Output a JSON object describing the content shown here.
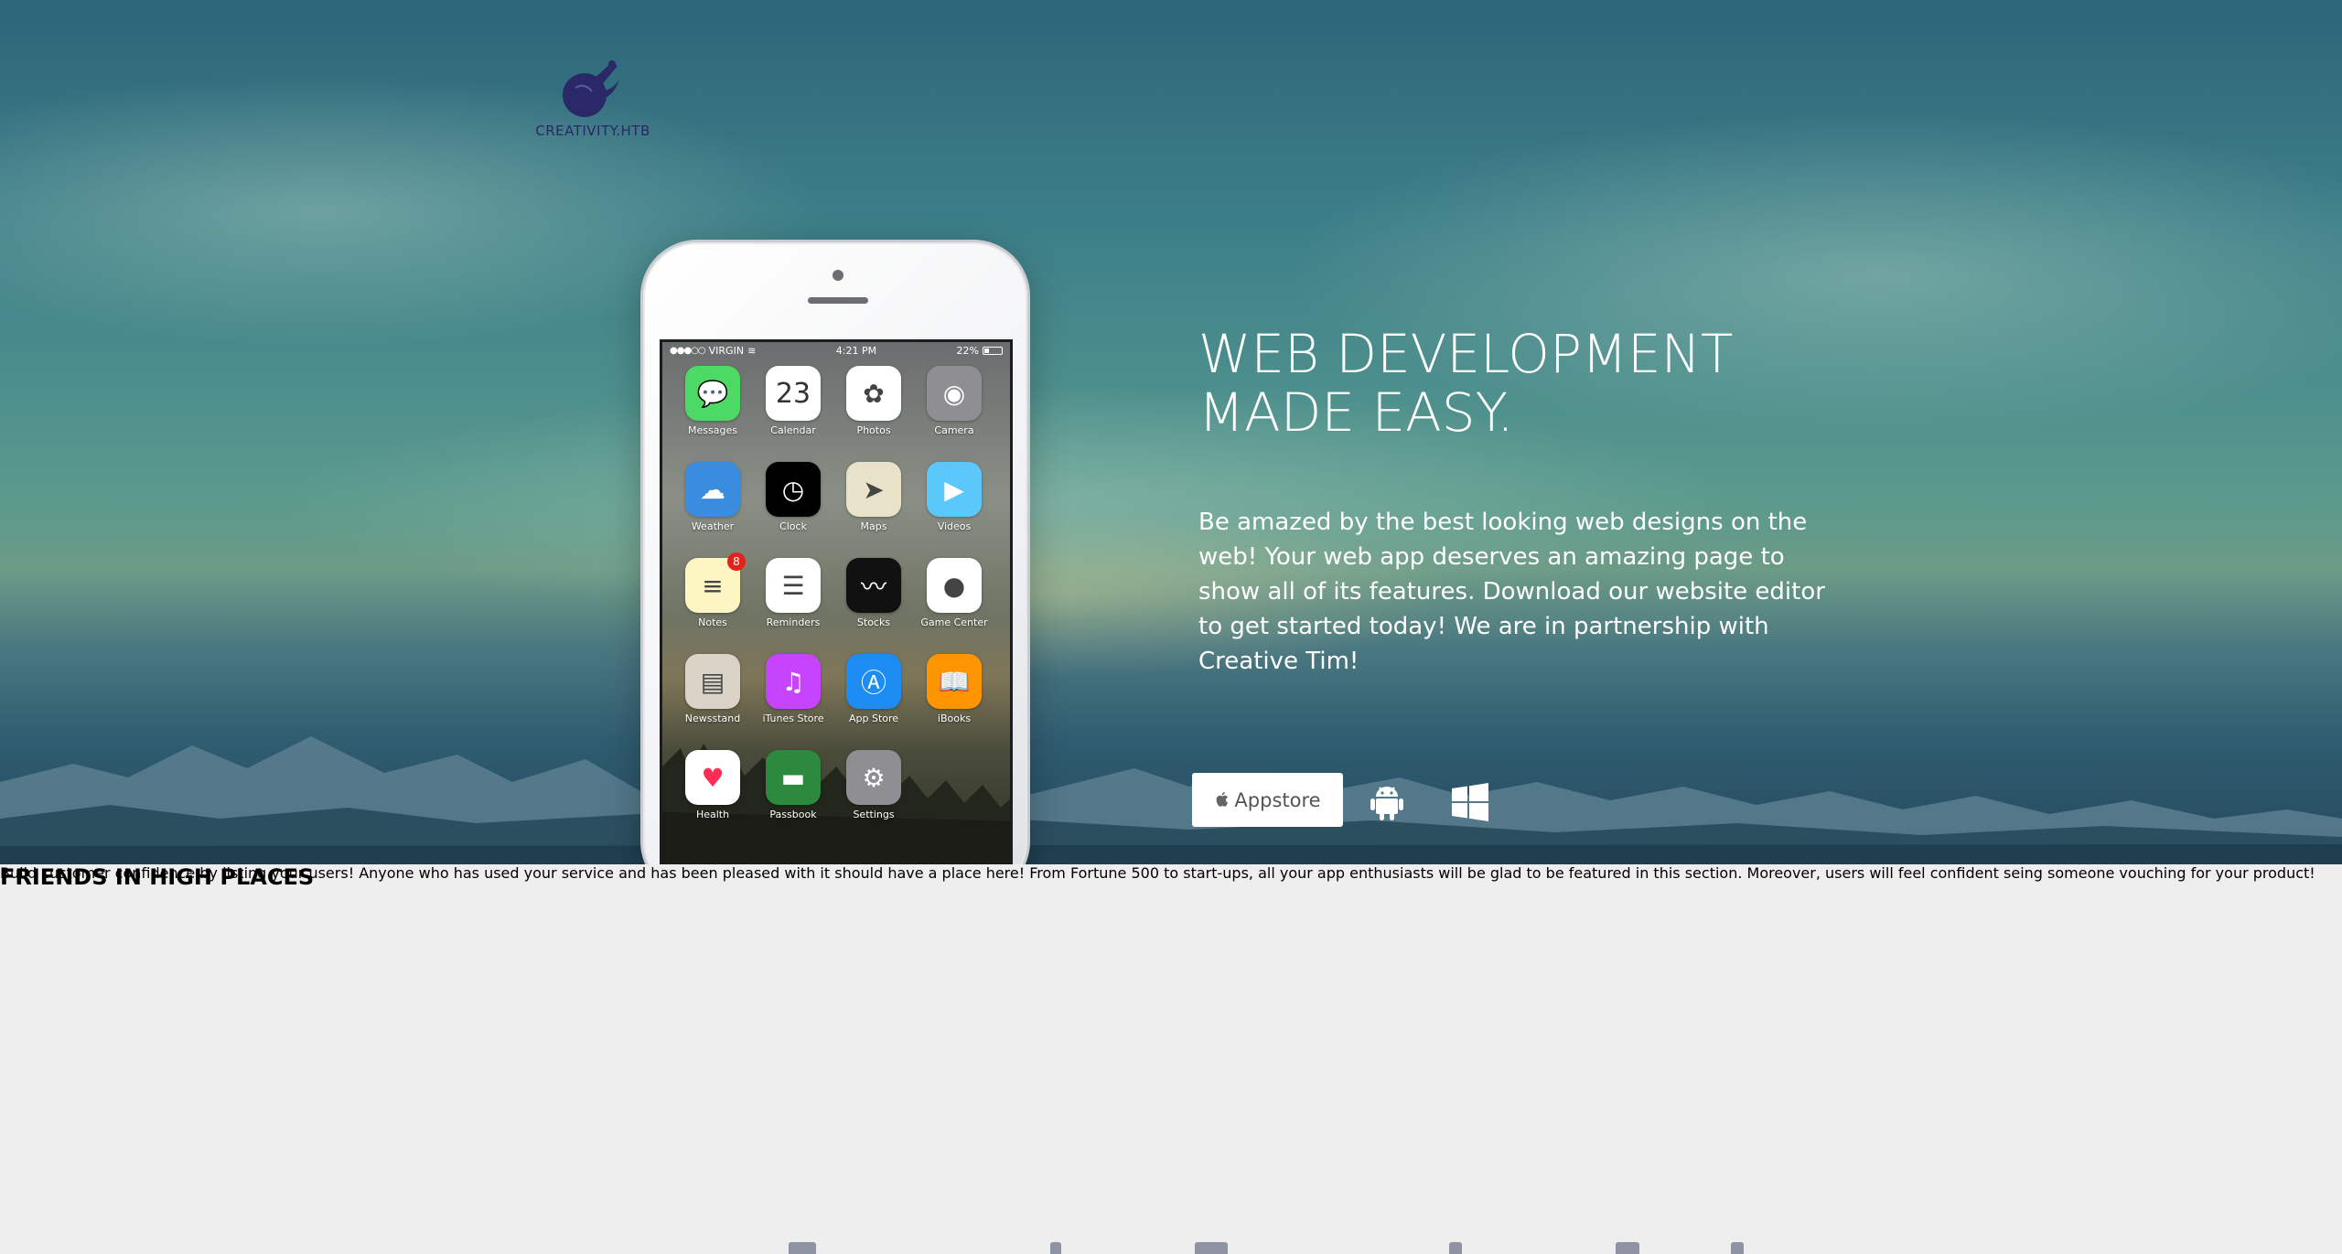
{
  "brand": {
    "logo_text": "CREATIVITY.HTB",
    "logo_color": "#2b2868"
  },
  "hero": {
    "headline_line1": "WEB DEVELOPMENT",
    "headline_line2": "MADE EASY.",
    "subtext": "Be amazed by the best looking web designs on the web! Your web app deserves an amazing page to show all of its features. Download our website editor to get started today! We are in partnership with Creative Tim!",
    "appstore_label": "Appstore",
    "platform_icons": [
      "apple-icon",
      "android-icon",
      "windows-icon"
    ]
  },
  "phone": {
    "status": {
      "carrier": "VIRGIN",
      "time": "4:21 PM",
      "battery": "22%"
    },
    "apps": [
      {
        "label": "Messages",
        "icon": "messages-icon",
        "color": "#4cd964"
      },
      {
        "label": "Calendar",
        "icon": "calendar-icon",
        "color": "#ffffff",
        "value": "23"
      },
      {
        "label": "Photos",
        "icon": "photos-icon",
        "color": "#ffffff"
      },
      {
        "label": "Camera",
        "icon": "camera-icon",
        "color": "#8e8e93"
      },
      {
        "label": "Weather",
        "icon": "weather-icon",
        "color": "#3a8dde"
      },
      {
        "label": "Clock",
        "icon": "clock-icon",
        "color": "#000000"
      },
      {
        "label": "Maps",
        "icon": "maps-icon",
        "color": "#e8e2c9"
      },
      {
        "label": "Videos",
        "icon": "videos-icon",
        "color": "#5ac8fa"
      },
      {
        "label": "Notes",
        "icon": "notes-icon",
        "color": "#fdf6c3",
        "badge": "8"
      },
      {
        "label": "Reminders",
        "icon": "reminders-icon",
        "color": "#ffffff"
      },
      {
        "label": "Stocks",
        "icon": "stocks-icon",
        "color": "#111111"
      },
      {
        "label": "Game Center",
        "icon": "game-center-icon",
        "color": "#ffffff"
      },
      {
        "label": "Newsstand",
        "icon": "newsstand-icon",
        "color": "#d9d4c7"
      },
      {
        "label": "iTunes Store",
        "icon": "itunes-icon",
        "color": "#c644fc"
      },
      {
        "label": "App Store",
        "icon": "app-store-icon",
        "color": "#1d8df4"
      },
      {
        "label": "iBooks",
        "icon": "ibooks-icon",
        "color": "#ff9500"
      },
      {
        "label": "Health",
        "icon": "health-icon",
        "color": "#ffffff"
      },
      {
        "label": "Passbook",
        "icon": "passbook-icon",
        "color": "#2b8a3e"
      },
      {
        "label": "Settings",
        "icon": "settings-icon",
        "color": "#8e8e93"
      }
    ]
  },
  "section": {
    "title": "FRIENDS IN HIGH PLACES",
    "body": "Build customer confidence by listing your users! Anyone who has used your service and has been pleased with it should have a place here! From Fortune 500 to start-ups, all your app enthusiasts will be glad to be featured in this section. Moreover, users will feel confident seing someone vouching for your product!"
  }
}
